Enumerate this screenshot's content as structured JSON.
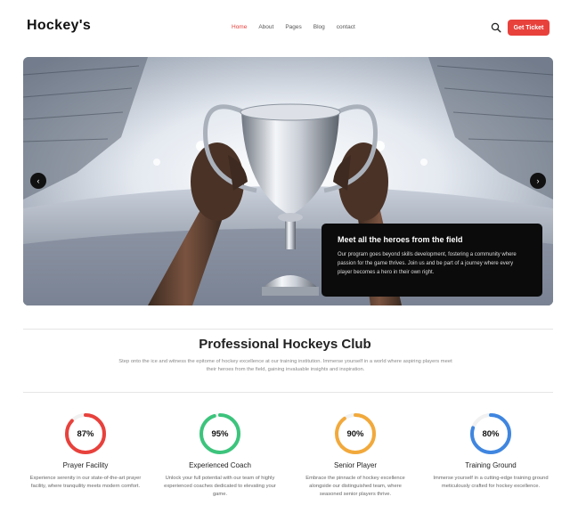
{
  "header": {
    "logo": "Hockey's",
    "nav": [
      "Home",
      "About",
      "Pages",
      "Blog",
      "contact"
    ],
    "active_nav": "Home",
    "cta": "Get Ticket",
    "accent_color": "#e8413c"
  },
  "hero": {
    "card_title": "Meet all the heroes from the field",
    "card_text": "Our program goes beyond skills development, fostering a community where passion for the game thrives. Join us and be part of a journey where every player becomes a hero in their own right.",
    "prev_icon": "chevron-left-icon",
    "next_icon": "chevron-right-icon"
  },
  "intro": {
    "title": "Professional Hockeys Club",
    "text": "Step onto the ice and witness the epitome of hockey excellence at our training institution. Immerse yourself in a world where aspiring players meet their heroes from the field, gaining invaluable insights and inspiration."
  },
  "stats": [
    {
      "value": "87%",
      "percent": 87,
      "color": "#e8413c",
      "title": "Prayer Facility",
      "text": "Experience serenity in our state-of-the-art prayer facility, where tranquility meets modern comfort."
    },
    {
      "value": "95%",
      "percent": 95,
      "color": "#3cc47c",
      "title": "Experienced Coach",
      "text": "Unlock your full potential with our team of highly experienced coaches dedicated to elevating your game."
    },
    {
      "value": "90%",
      "percent": 90,
      "color": "#f2a93b",
      "title": "Senior Player",
      "text": "Embrace the pinnacle of hockey excellence alongside our distinguished team, where seasoned senior players thrive."
    },
    {
      "value": "80%",
      "percent": 80,
      "color": "#3f86e0",
      "title": "Training Ground",
      "text": "Immerse yourself in a cutting-edge training ground meticulously crafted for hockey excellence."
    }
  ]
}
